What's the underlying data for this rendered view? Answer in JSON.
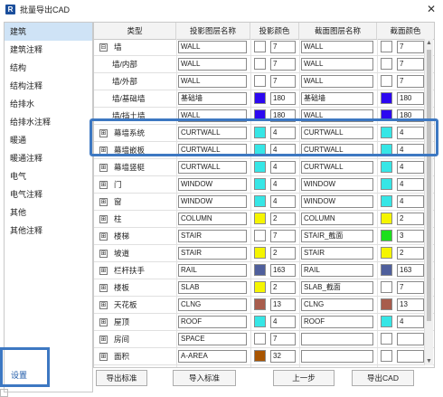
{
  "window": {
    "title": "批量导出CAD",
    "app_icon": "R",
    "close_glyph": "✕"
  },
  "categories": [
    "建筑",
    "建筑注释",
    "结构",
    "结构注释",
    "给排水",
    "给排水注释",
    "暖通",
    "暖通注释",
    "电气",
    "电气注释",
    "其他",
    "其他注释"
  ],
  "selected_category": 0,
  "settings_label": "设置",
  "columns": [
    "类型",
    "投影图层名称",
    "投影颜色",
    "截面图层名称",
    "截面颜色"
  ],
  "rows": [
    {
      "type": "墙",
      "toggle": "⊟",
      "proj_layer": "WALL",
      "proj_color": "#ffffff",
      "proj_num": "7",
      "cut_layer": "WALL",
      "cut_color": "#ffffff",
      "cut_num": "7"
    },
    {
      "type": "墙/内部",
      "toggle": "",
      "proj_layer": "WALL",
      "proj_color": "#ffffff",
      "proj_num": "7",
      "cut_layer": "WALL",
      "cut_color": "#ffffff",
      "cut_num": "7"
    },
    {
      "type": "墙/外部",
      "toggle": "",
      "proj_layer": "WALL",
      "proj_color": "#ffffff",
      "proj_num": "7",
      "cut_layer": "WALL",
      "cut_color": "#ffffff",
      "cut_num": "7"
    },
    {
      "type": "墙/基础墙",
      "toggle": "",
      "proj_layer": "基础墙",
      "proj_color": "#2c08f0",
      "proj_num": "180",
      "cut_layer": "基础墙",
      "cut_color": "#2c08f0",
      "cut_num": "180"
    },
    {
      "type": "墙/挡土墙",
      "toggle": "",
      "proj_layer": "WALL",
      "proj_color": "#2c08f0",
      "proj_num": "180",
      "cut_layer": "WALL",
      "cut_color": "#2c08f0",
      "cut_num": "180"
    },
    {
      "type": "幕墙系统",
      "toggle": "⊞",
      "proj_layer": "CURTWALL",
      "proj_color": "#36e6e6",
      "proj_num": "4",
      "cut_layer": "CURTWALL",
      "cut_color": "#36e6e6",
      "cut_num": "4"
    },
    {
      "type": "幕墙嵌板",
      "toggle": "⊞",
      "proj_layer": "CURTWALL",
      "proj_color": "#36e6e6",
      "proj_num": "4",
      "cut_layer": "CURTWALL",
      "cut_color": "#36e6e6",
      "cut_num": "4"
    },
    {
      "type": "幕墙竖梃",
      "toggle": "⊞",
      "proj_layer": "CURTWALL",
      "proj_color": "#36e6e6",
      "proj_num": "4",
      "cut_layer": "CURTWALL",
      "cut_color": "#36e6e6",
      "cut_num": "4"
    },
    {
      "type": "门",
      "toggle": "⊞",
      "proj_layer": "WINDOW",
      "proj_color": "#36e6e6",
      "proj_num": "4",
      "cut_layer": "WINDOW",
      "cut_color": "#36e6e6",
      "cut_num": "4"
    },
    {
      "type": "窗",
      "toggle": "⊞",
      "proj_layer": "WINDOW",
      "proj_color": "#36e6e6",
      "proj_num": "4",
      "cut_layer": "WINDOW",
      "cut_color": "#36e6e6",
      "cut_num": "4"
    },
    {
      "type": "柱",
      "toggle": "⊞",
      "proj_layer": "COLUMN",
      "proj_color": "#f5f500",
      "proj_num": "2",
      "cut_layer": "COLUMN",
      "cut_color": "#f5f500",
      "cut_num": "2"
    },
    {
      "type": "楼梯",
      "toggle": "⊞",
      "proj_layer": "STAIR",
      "proj_color": "#ffffff",
      "proj_num": "7",
      "cut_layer": "STAIR_截面",
      "cut_color": "#1de01d",
      "cut_num": "3"
    },
    {
      "type": "坡道",
      "toggle": "⊞",
      "proj_layer": "STAIR",
      "proj_color": "#f5f500",
      "proj_num": "2",
      "cut_layer": "STAIR",
      "cut_color": "#f5f500",
      "cut_num": "2"
    },
    {
      "type": "栏杆扶手",
      "toggle": "⊞",
      "proj_layer": "RAIL",
      "proj_color": "#4f5f9c",
      "proj_num": "163",
      "cut_layer": "RAIL",
      "cut_color": "#4f5f9c",
      "cut_num": "163"
    },
    {
      "type": "楼板",
      "toggle": "⊞",
      "proj_layer": "SLAB",
      "proj_color": "#f5f500",
      "proj_num": "2",
      "cut_layer": "SLAB_截面",
      "cut_color": "#ffffff",
      "cut_num": "7"
    },
    {
      "type": "天花板",
      "toggle": "⊞",
      "proj_layer": "CLNG",
      "proj_color": "#a85c4c",
      "proj_num": "13",
      "cut_layer": "CLNG",
      "cut_color": "#a85c4c",
      "cut_num": "13"
    },
    {
      "type": "屋顶",
      "toggle": "⊞",
      "proj_layer": "ROOF",
      "proj_color": "#36e6e6",
      "proj_num": "4",
      "cut_layer": "ROOF",
      "cut_color": "#36e6e6",
      "cut_num": "4"
    },
    {
      "type": "房间",
      "toggle": "⊞",
      "proj_layer": "SPACE",
      "proj_color": "#ffffff",
      "proj_num": "7",
      "cut_layer": "",
      "cut_color": "#ffffff",
      "cut_num": ""
    },
    {
      "type": "面积",
      "toggle": "⊞",
      "proj_layer": "A-AREA",
      "proj_color": "#a85400",
      "proj_num": "32",
      "cut_layer": "",
      "cut_color": "#ffffff",
      "cut_num": ""
    },
    {
      "type": "空间",
      "toggle": "⊞",
      "proj_layer": "M-AREA",
      "proj_color": "#a85400",
      "proj_num": "32",
      "cut_layer": "",
      "cut_color": "#ffffff",
      "cut_num": ""
    }
  ],
  "buttons": {
    "export_std": "导出标准",
    "import_std": "导入标准",
    "prev": "上一步",
    "export_cad": "导出CAD"
  }
}
